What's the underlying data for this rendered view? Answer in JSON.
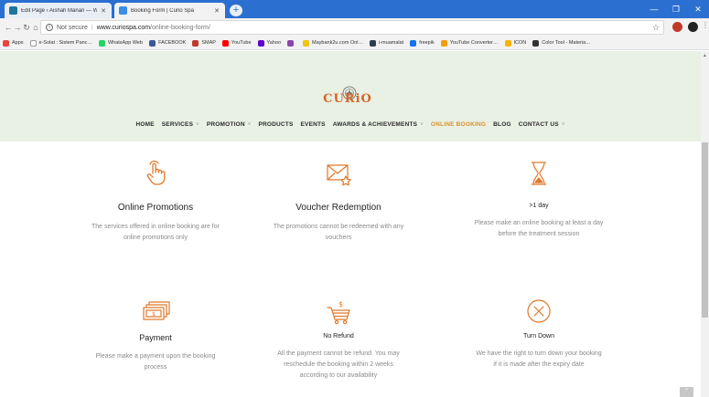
{
  "browser": {
    "tabs": [
      {
        "title": "Edit Page ‹ Aishah Manan — Wo…",
        "favicon_color": "#21759b"
      },
      {
        "title": "Booking Form | Curio Spa",
        "favicon_color": "#3a8ee6"
      }
    ],
    "new_tab": "+",
    "url": {
      "security_label": "Not secure",
      "domain": "www.curiospa.com",
      "path": "/online-booking-form/"
    },
    "bookmarks": [
      {
        "label": "Apps",
        "color": "#e8453c"
      },
      {
        "label": "e-Solat : Sistem Panc…",
        "color": "#ffffff"
      },
      {
        "label": "WhatsApp Web",
        "color": "#25d366"
      },
      {
        "label": "FACEBOOK",
        "color": "#3b5998"
      },
      {
        "label": "SMAP",
        "color": "#c0392b"
      },
      {
        "label": "YouTube",
        "color": "#ff0000"
      },
      {
        "label": "Yahoo",
        "color": "#5f01d1"
      },
      {
        "label": "",
        "color": "#8e44ad"
      },
      {
        "label": "Maybank2u.com Onl…",
        "color": "#f1c40f"
      },
      {
        "label": "i-muamalat",
        "color": "#2c3e50"
      },
      {
        "label": "freepik",
        "color": "#1273eb"
      },
      {
        "label": "YouTube Converter…",
        "color": "#f39c12"
      },
      {
        "label": "ICON",
        "color": "#f4b400"
      },
      {
        "label": "Color Tool - Materia…",
        "color": "#333333"
      }
    ]
  },
  "site": {
    "logo_text": "CURiO",
    "nav": [
      {
        "label": "HOME",
        "dropdown": false,
        "active": false
      },
      {
        "label": "SERVICES",
        "dropdown": true,
        "active": false
      },
      {
        "label": "PROMOTION",
        "dropdown": true,
        "active": false
      },
      {
        "label": "PRODUCTS",
        "dropdown": false,
        "active": false
      },
      {
        "label": "EVENTS",
        "dropdown": false,
        "active": false
      },
      {
        "label": "AWARDS & ACHIEVEMENTS",
        "dropdown": true,
        "active": false
      },
      {
        "label": "ONLINE BOOKING",
        "dropdown": false,
        "active": true
      },
      {
        "label": "BLOG",
        "dropdown": false,
        "active": false
      },
      {
        "label": "CONTACT US",
        "dropdown": true,
        "active": false
      }
    ],
    "chevron": "˅",
    "accent_color": "#d8932c",
    "logo_color": "#d7662a"
  },
  "features": [
    {
      "icon": "hand-touch-icon",
      "title": "Online Promotions",
      "desc": [
        "The services offered in online booking are for",
        "online promotions only"
      ]
    },
    {
      "icon": "envelope-star-icon",
      "title": "Voucher Redemption",
      "desc": [
        "The promotions cannot be redeemed with any",
        "vouchers"
      ]
    },
    {
      "icon": "hourglass-icon",
      "title": ">1 day",
      "desc": [
        "Please make an online booking at least a day",
        "before the treatment session"
      ]
    },
    {
      "icon": "cash-icon",
      "title": "Payment",
      "desc": [
        "Please make a payment upon the booking",
        "process"
      ]
    },
    {
      "icon": "cart-dollar-icon",
      "title": "No Refund",
      "desc": [
        "All the payment cannot be refund. You may",
        "reschedule the booking within 2 weeks",
        "according to our availability"
      ]
    },
    {
      "icon": "circle-x-icon",
      "title": "Turn Down",
      "desc": [
        "We have the right to turn down your booking",
        "if it is made after the expiry date"
      ]
    }
  ]
}
